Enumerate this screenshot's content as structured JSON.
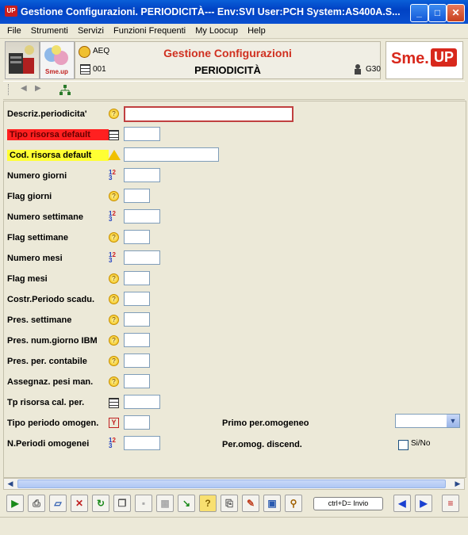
{
  "window": {
    "title": "Gestione Configurazioni. PERIODICITÀ--- Env:SVI User:PCH System:AS400A.S...",
    "app_icon": "UP"
  },
  "menu": [
    "File",
    "Strumenti",
    "Servizi",
    "Funzioni Frequenti",
    "My Loocup",
    "Help"
  ],
  "header": {
    "code1": "AEQ",
    "code2": "001",
    "title": "Gestione Configurazioni",
    "subtitle": "PERIODICITÀ",
    "group": "G30",
    "brand_text": "Sme.",
    "brand_up": "UP",
    "logo2_text": "Sme.up"
  },
  "form": {
    "fields": [
      {
        "label": "Descriz.periodicita'",
        "icon": "help-icon"
      },
      {
        "label": "Tipo risorsa default",
        "icon": "table-icon"
      },
      {
        "label": "Cod. risorsa default",
        "icon": "warning-icon"
      },
      {
        "label": "Numero giorni",
        "icon": "number-icon"
      },
      {
        "label": "Flag giorni",
        "icon": "help-icon"
      },
      {
        "label": "Numero settimane",
        "icon": "number-icon"
      },
      {
        "label": "Flag settimane",
        "icon": "help-icon"
      },
      {
        "label": "Numero mesi",
        "icon": "number-icon"
      },
      {
        "label": "Flag mesi",
        "icon": "help-icon"
      },
      {
        "label": "Costr.Periodo scadu.",
        "icon": "help-icon"
      },
      {
        "label": "Pres. settimane",
        "icon": "help-icon"
      },
      {
        "label": "Pres. num.giorno IBM",
        "icon": "help-icon"
      },
      {
        "label": "Pres. per. contabile",
        "icon": "help-icon"
      },
      {
        "label": "Assegnaz. pesi man.",
        "icon": "help-icon"
      },
      {
        "label": "Tp risorsa cal. per.",
        "icon": "table-icon"
      },
      {
        "label": "Tipo periodo omogen.",
        "icon": "y-icon"
      },
      {
        "label": "N.Periodi omogenei",
        "icon": "number-icon"
      }
    ],
    "right": {
      "primo_label": "Primo per.omogeneo",
      "discend_label": "Per.omog. discend.",
      "sino_label": "Si/No"
    }
  },
  "toolbar": {
    "invio_label": "ctrl+D= Invio"
  }
}
